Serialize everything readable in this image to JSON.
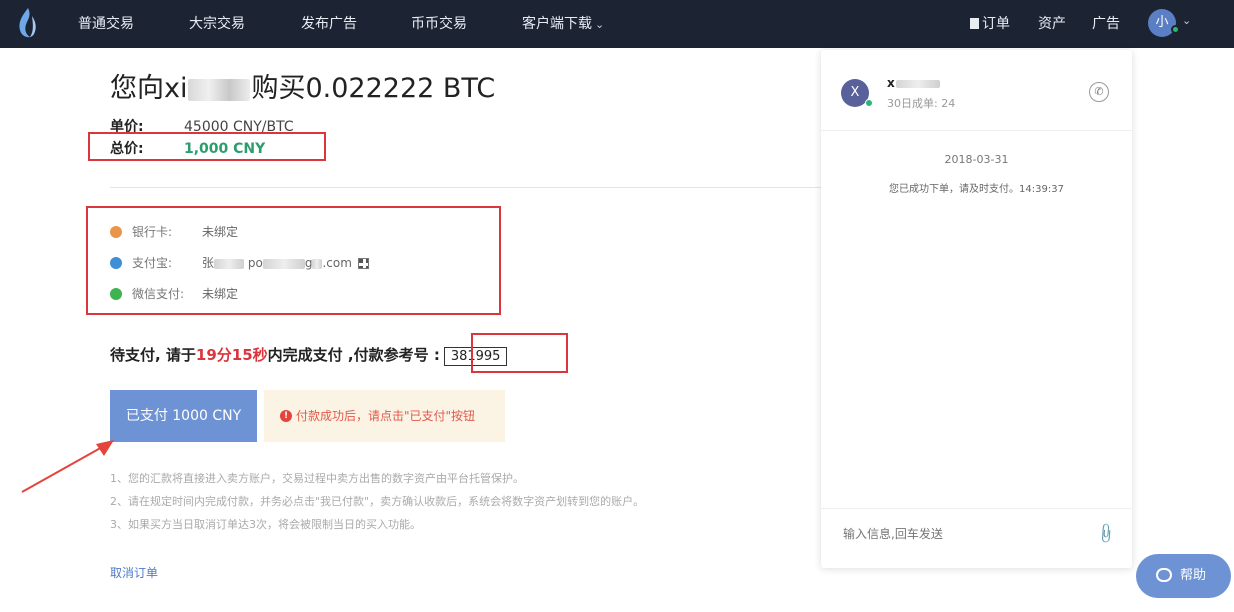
{
  "nav": {
    "links": [
      "普通交易",
      "大宗交易",
      "发布广告",
      "币币交易",
      "客户端下载"
    ],
    "orders": "订单",
    "assets": "资产",
    "ads": "广告",
    "avatar_char": "小"
  },
  "order": {
    "title_prefix": "您向xi",
    "title_suffix": "购买0.022222 BTC",
    "unit_price_label": "单价:",
    "unit_price_value": "45000 CNY/BTC",
    "total_label": "总价:",
    "total_value": "1,000 CNY"
  },
  "payment_methods": [
    {
      "name": "银行卡:",
      "value": "未绑定",
      "icon": "bank-card-icon",
      "color": "#e9964a"
    },
    {
      "name": "支付宝:",
      "value_prefix": "张",
      "value_mid": "po",
      "value_mid2": "g",
      "value_suffix": ".com",
      "icon": "alipay-icon",
      "color": "#3f8fd6"
    },
    {
      "name": "微信支付:",
      "value": "未绑定",
      "icon": "wechat-icon",
      "color": "#3fb34f"
    }
  ],
  "await": {
    "prefix": "待支付,  请于",
    "time": "19分15秒",
    "suffix": "内完成支付 ,付款参考号 :",
    "ref_no": "381995"
  },
  "paid_button": "已支付 1000 CNY",
  "notice": "付款成功后，请点击\"已支付\"按钮",
  "notes": [
    "1、您的汇款将直接进入卖方账户，交易过程中卖方出售的数字资产由平台托管保护。",
    "2、请在规定时间内完成付款，并务必点击\"我已付款\"，卖方确认收款后，系统会将数字资产划转到您的账户。",
    "3、如果买方当日取消订单达3次，将会被限制当日的买入功能。"
  ],
  "cancel": "取消订单",
  "chat": {
    "avatar_char": "X",
    "name_prefix": "x",
    "stat": "30日成单: 24",
    "date": "2018-03-31",
    "message": "您已成功下单，请及时支付。14:39:37",
    "input_placeholder": "输入信息,回车发送"
  },
  "help": "帮助",
  "colors": {
    "nav_bg": "#1c2434",
    "accent_blue": "#6d93d4",
    "total_green": "#2b9d6e",
    "countdown_red": "#d9363e",
    "annotation_red": "#d9363e"
  }
}
